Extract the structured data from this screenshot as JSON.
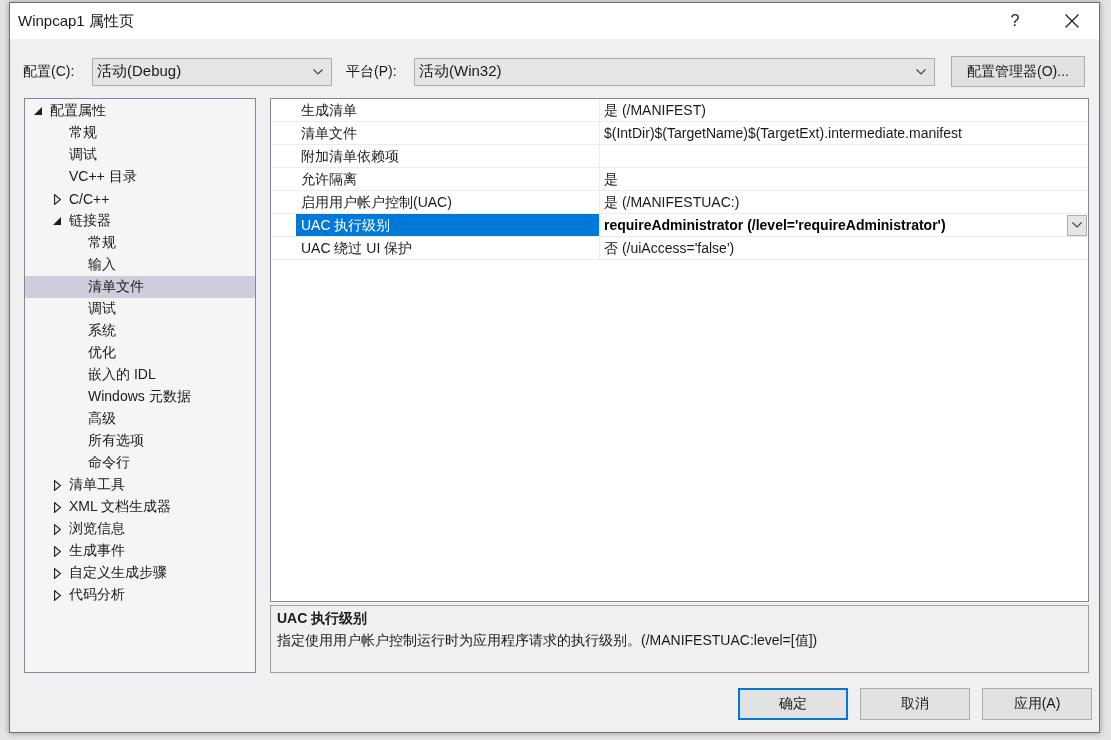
{
  "window": {
    "title": "Winpcap1 属性页",
    "help_button": "?"
  },
  "configuration": {
    "label": "配置(C):",
    "value": "活动(Debug)"
  },
  "platform": {
    "label": "平台(P):",
    "value": "活动(Win32)"
  },
  "configuration_manager_button": "配置管理器(O)...",
  "tree": {
    "items": [
      {
        "label": "配置属性",
        "expanded": true,
        "selected": false,
        "children": [
          {
            "label": "常规",
            "selected": false
          },
          {
            "label": "调试",
            "selected": false
          },
          {
            "label": "VC++ 目录",
            "selected": false
          },
          {
            "label": "C/C++",
            "expanded": false,
            "selected": false
          },
          {
            "label": "链接器",
            "expanded": true,
            "selected": false,
            "children": [
              {
                "label": "常规",
                "selected": false
              },
              {
                "label": "输入",
                "selected": false
              },
              {
                "label": "清单文件",
                "selected": true
              },
              {
                "label": "调试",
                "selected": false
              },
              {
                "label": "系统",
                "selected": false
              },
              {
                "label": "优化",
                "selected": false
              },
              {
                "label": "嵌入的 IDL",
                "selected": false
              },
              {
                "label": "Windows 元数据",
                "selected": false
              },
              {
                "label": "高级",
                "selected": false
              },
              {
                "label": "所有选项",
                "selected": false
              },
              {
                "label": "命令行",
                "selected": false
              }
            ]
          },
          {
            "label": "清单工具",
            "expanded": false,
            "selected": false
          },
          {
            "label": "XML 文档生成器",
            "expanded": false,
            "selected": false
          },
          {
            "label": "浏览信息",
            "expanded": false,
            "selected": false
          },
          {
            "label": "生成事件",
            "expanded": false,
            "selected": false
          },
          {
            "label": "自定义生成步骤",
            "expanded": false,
            "selected": false
          },
          {
            "label": "代码分析",
            "expanded": false,
            "selected": false
          }
        ]
      }
    ]
  },
  "properties": [
    {
      "name": "生成清单",
      "value": "是 (/MANIFEST)",
      "selected": false,
      "modified": false
    },
    {
      "name": "清单文件",
      "value": "$(IntDir)$(TargetName)$(TargetExt).intermediate.manifest",
      "selected": false,
      "modified": false
    },
    {
      "name": "附加清单依赖项",
      "selected": false
    },
    {
      "name": "允许隔离",
      "value": "是",
      "selected": false,
      "modified": false
    },
    {
      "name": "启用用户帐户控制(UAC)",
      "value": "是 (/MANIFESTUAC:)",
      "selected": false,
      "modified": false
    },
    {
      "name": "UAC 执行级别",
      "value": "requireAdministrator (/level='requireAdministrator')",
      "selected": true,
      "modified": true
    },
    {
      "name": "UAC 绕过 UI 保护",
      "value": "否 (/uiAccess='false')",
      "selected": false,
      "modified": false
    }
  ],
  "description": {
    "title": "UAC 执行级别",
    "text": "指定使用用户帐户控制运行时为应用程序请求的执行级别。(/MANIFESTUAC:level=[值])"
  },
  "buttons": [
    {
      "label": "确定",
      "default": true
    },
    {
      "label": "取消",
      "default": false
    },
    {
      "label": "应用(A)",
      "default": false
    }
  ]
}
